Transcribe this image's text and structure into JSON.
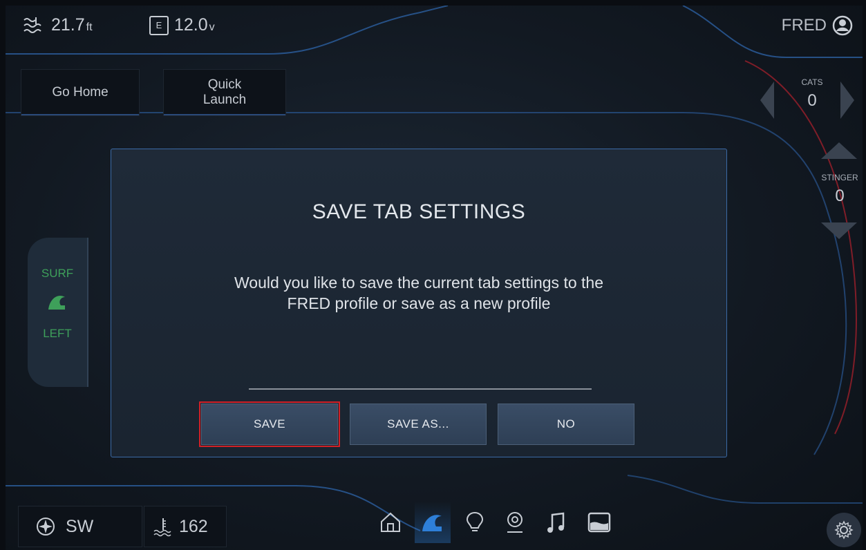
{
  "status": {
    "depth_value": "21.7",
    "depth_unit": "ft",
    "battery_value": "12.0",
    "battery_unit": "v",
    "battery_icon_letter": "E",
    "user_name": "FRED"
  },
  "top_buttons": {
    "go_home": "Go Home",
    "quick_launch_line1": "Quick",
    "quick_launch_line2": "Launch"
  },
  "right_indicators": {
    "cats_label": "CATS",
    "cats_value": "0",
    "stinger_label": "STINGER",
    "stinger_value": "0"
  },
  "surf_panel": {
    "top_label": "SURF",
    "bottom_label": "LEFT"
  },
  "dialog": {
    "title": "SAVE TAB SETTINGS",
    "message": "Would you like to save the current tab settings to the FRED profile or save as a new profile",
    "buttons": {
      "save": "SAVE",
      "save_as": "SAVE AS...",
      "no": "NO"
    }
  },
  "bottom": {
    "heading": "SW",
    "water_temp": "162"
  },
  "icons": [
    "depth-icon",
    "battery-icon",
    "user-icon",
    "compass-icon",
    "water-temp-icon",
    "home-icon",
    "wave-icon",
    "light-bulb-icon",
    "location-icon",
    "music-icon",
    "ballast-icon",
    "gear-icon",
    "surf-wave-icon"
  ],
  "colors": {
    "accent_blue": "#3b6aa6",
    "focus_red": "#d22027",
    "surf_green": "#3ea05a",
    "active_nav_blue": "#2e7fd8"
  }
}
